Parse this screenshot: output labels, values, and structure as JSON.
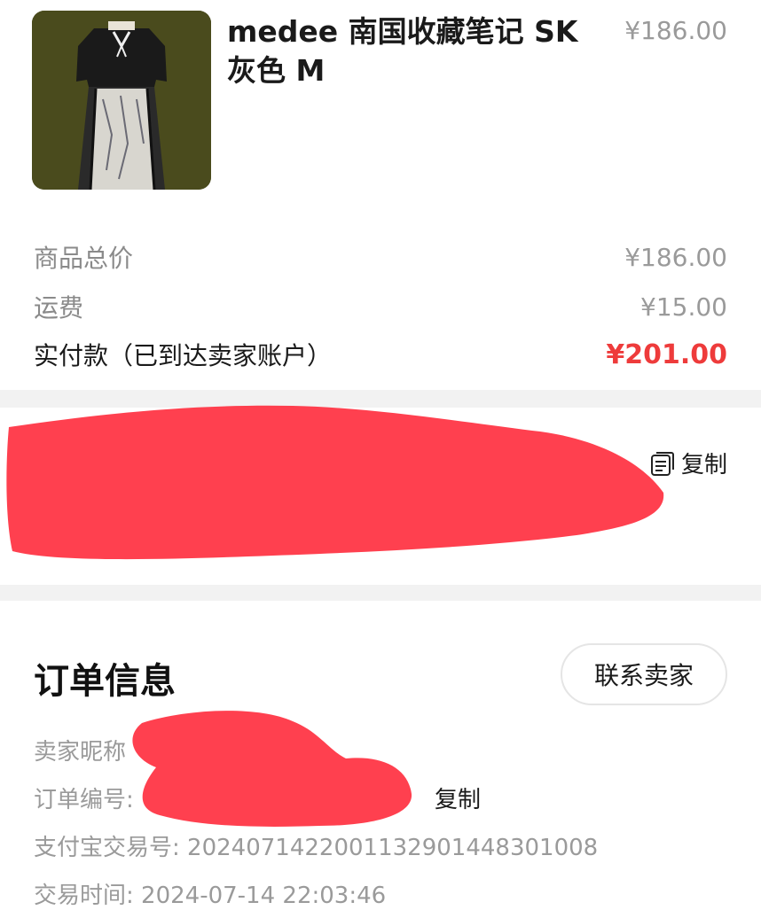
{
  "product": {
    "title": "medee 南国收藏笔记 SK 灰色 M",
    "price": "¥186.00",
    "image": "dress-photo"
  },
  "summary": {
    "goods_total_label": "商品总价",
    "goods_total_value": "¥186.00",
    "shipping_label": "运费",
    "shipping_value": "¥15.00",
    "paid_label": "实付款（已到达卖家账户）",
    "paid_value": "¥201.00"
  },
  "address": {
    "copy_label": "复制",
    "copy_icon": "copy-document-icon"
  },
  "order": {
    "title": "订单信息",
    "contact_label": "联系卖家",
    "seller_nick_label": "卖家昵称",
    "order_no_label": "订单编号:",
    "order_copy_label": "复制",
    "alipay_label": "支付宝交易号:",
    "alipay_value": "2024071422001132901448301008",
    "time_label": "交易时间:",
    "time_value": "2024-07-14 22:03:46"
  },
  "colors": {
    "accent_red": "#ee3b3b",
    "redaction": "#ff3040"
  }
}
